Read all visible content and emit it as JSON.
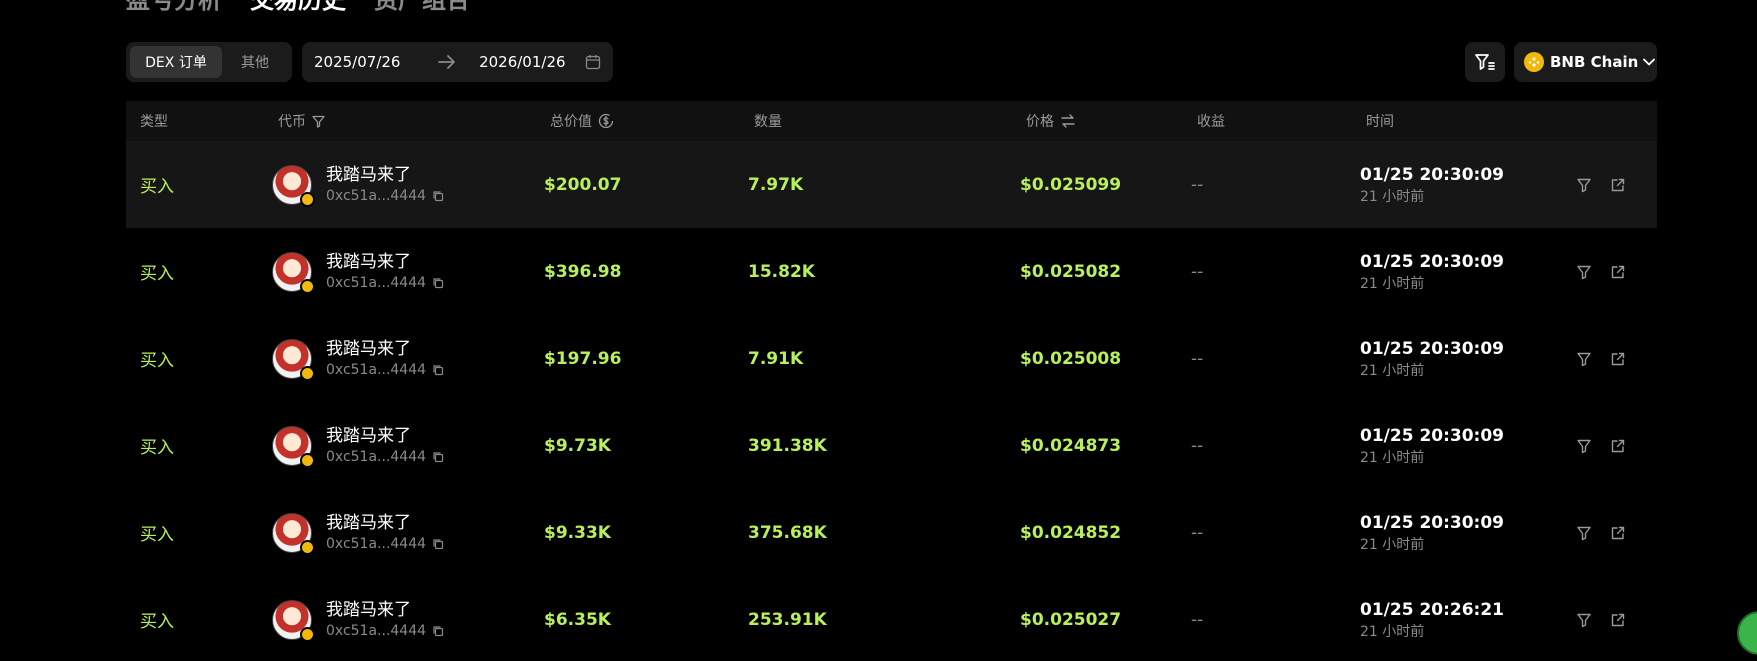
{
  "top_tabs": [
    {
      "label": "盈亏分析",
      "active": false
    },
    {
      "label": "交易历史",
      "active": true
    },
    {
      "label": "资产组合",
      "active": false
    }
  ],
  "filters": {
    "segment": {
      "active": "DEX 订单",
      "other": "其他"
    },
    "date_start": "2025/07/26",
    "date_end": "2026/01/26",
    "chain": "BNB Chain"
  },
  "table": {
    "headers": {
      "type": "类型",
      "token": "代币",
      "total_value": "总价值",
      "quantity": "数量",
      "price": "价格",
      "profit": "收益",
      "time": "时间"
    },
    "rows": [
      {
        "type": "买入",
        "token_name": "我踏马来了",
        "token_address": "0xc51a...4444",
        "total_value": "$200.07",
        "quantity": "7.97K",
        "price": "$0.025099",
        "profit": "--",
        "time": "01/25 20:30:09",
        "ago": "21 小时前"
      },
      {
        "type": "买入",
        "token_name": "我踏马来了",
        "token_address": "0xc51a...4444",
        "total_value": "$396.98",
        "quantity": "15.82K",
        "price": "$0.025082",
        "profit": "--",
        "time": "01/25 20:30:09",
        "ago": "21 小时前"
      },
      {
        "type": "买入",
        "token_name": "我踏马来了",
        "token_address": "0xc51a...4444",
        "total_value": "$197.96",
        "quantity": "7.91K",
        "price": "$0.025008",
        "profit": "--",
        "time": "01/25 20:30:09",
        "ago": "21 小时前"
      },
      {
        "type": "买入",
        "token_name": "我踏马来了",
        "token_address": "0xc51a...4444",
        "total_value": "$9.73K",
        "quantity": "391.38K",
        "price": "$0.024873",
        "profit": "--",
        "time": "01/25 20:30:09",
        "ago": "21 小时前"
      },
      {
        "type": "买入",
        "token_name": "我踏马来了",
        "token_address": "0xc51a...4444",
        "total_value": "$9.33K",
        "quantity": "375.68K",
        "price": "$0.024852",
        "profit": "--",
        "time": "01/25 20:30:09",
        "ago": "21 小时前"
      },
      {
        "type": "买入",
        "token_name": "我踏马来了",
        "token_address": "0xc51a...4444",
        "total_value": "$6.35K",
        "quantity": "253.91K",
        "price": "$0.025027",
        "profit": "--",
        "time": "01/25 20:26:21",
        "ago": "21 小时前"
      }
    ]
  },
  "colors": {
    "background": "#000000",
    "positive": "#b7f05a",
    "muted": "#8a8a8a",
    "panel": "#1b1b1b",
    "bnb": "#f0b90b"
  },
  "icons": {
    "filter": "filter-icon",
    "calendar": "calendar-icon",
    "copy": "copy-icon",
    "external_link": "external-link-icon",
    "swap": "swap-icon",
    "dollar_circle": "dollar-circle-icon"
  }
}
